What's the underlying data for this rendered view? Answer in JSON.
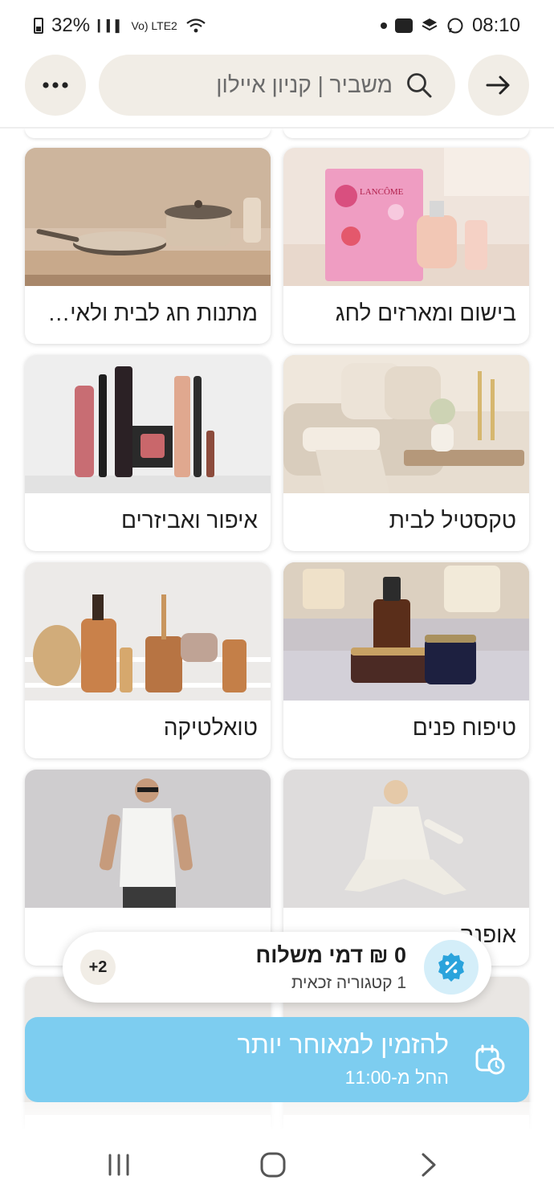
{
  "status_bar": {
    "battery": "32%",
    "network": "Vo) LTE2",
    "time": "08:10"
  },
  "top_bar": {
    "search_text": "משביר | קניון איילון",
    "icons": [
      "more-icon",
      "search-icon",
      "arrow-right-icon"
    ]
  },
  "categories": [
    {
      "label": "בישום ומארזים לחג",
      "image": "perfume-gift-box"
    },
    {
      "label": "מתנות חג לבית ולאירוח",
      "image": "cookware-pans"
    },
    {
      "label": "טקסטיל לבית",
      "image": "sofa-textiles"
    },
    {
      "label": "איפור ואביזרים",
      "image": "makeup-products"
    },
    {
      "label": "טיפוח פנים",
      "image": "skincare-serum"
    },
    {
      "label": "טואלטיקה",
      "image": "bath-accessories"
    },
    {
      "label": "אופנה",
      "image": "woman-fashion"
    },
    {
      "label": "",
      "image": "man-fashion"
    }
  ],
  "promo": {
    "title": "0 ₪ דמי משלוח",
    "subtitle": "1 קטגוריה זכאית",
    "count": "+2",
    "icon": "discount-badge-icon"
  },
  "schedule": {
    "title": "להזמין למאוחר יותר",
    "subtitle": "החל מ-11:00",
    "icon": "calendar-clock-icon"
  },
  "colors": {
    "accent": "#7dcdf0",
    "chip_bg": "#f1ede6",
    "promo_icon": "#2aa3dc"
  }
}
